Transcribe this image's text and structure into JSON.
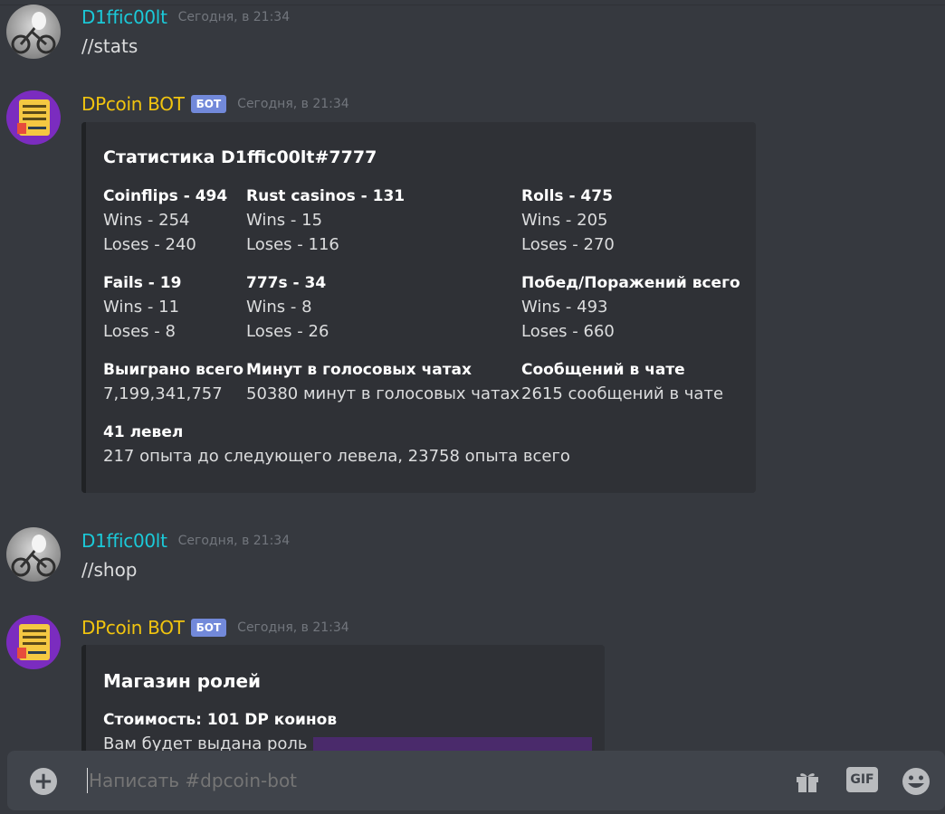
{
  "messages": [
    {
      "author": "D1ffic00lt",
      "timestamp": "Сегодня, в 21:34",
      "text": "//stats"
    },
    {
      "author": "DPcoin BOT",
      "badge": "БОТ",
      "timestamp": "Сегодня, в 21:34"
    },
    {
      "author": "D1ffic00lt",
      "timestamp": "Сегодня, в 21:34",
      "text": "//shop"
    },
    {
      "author": "DPcoin BOT",
      "badge": "БОТ",
      "timestamp": "Сегодня, в 21:34"
    }
  ],
  "stats_embed": {
    "title": "Статистика D1ffic00lt#7777",
    "fields": [
      {
        "name": "Coinflips - 494",
        "lines": [
          "Wins - 254",
          "Loses - 240"
        ]
      },
      {
        "name": "Rust casinos - 131",
        "lines": [
          "Wins - 15",
          "Loses - 116"
        ]
      },
      {
        "name": "Rolls - 475",
        "lines": [
          "Wins - 205",
          "Loses - 270"
        ]
      },
      {
        "name": "Fails - 19",
        "lines": [
          "Wins - 11",
          "Loses - 8"
        ]
      },
      {
        "name": "777s - 34",
        "lines": [
          "Wins - 8",
          "Loses - 26"
        ]
      },
      {
        "name": "Побед/Поражений всего",
        "lines": [
          "Wins - 493",
          "Loses - 660"
        ]
      },
      {
        "name": "Выиграно всего",
        "lines": [
          "7,199,341,757"
        ]
      },
      {
        "name": "Минут в голосовых чатах",
        "lines": [
          "50380 минут в голосовых чатах"
        ]
      },
      {
        "name": "Сообщений в чате",
        "lines": [
          "2615 сообщений в чате"
        ]
      },
      {
        "name": "41 левел",
        "lines": [
          "217 опыта до следующего левела, 23758 опыта всего"
        ]
      }
    ]
  },
  "shop_embed": {
    "title": "Магазин ролей",
    "field_name": "Стоимость: 101 DP коинов",
    "field_value": "Вам будет выдана роль"
  },
  "composer": {
    "placeholder": "Написать #dpcoin-bot",
    "plus_label": "+",
    "gif_label": "GIF"
  },
  "icons": {
    "add": "plus-circle-icon",
    "gift": "gift-icon",
    "gif": "gif-icon",
    "emoji": "emoji-icon"
  }
}
